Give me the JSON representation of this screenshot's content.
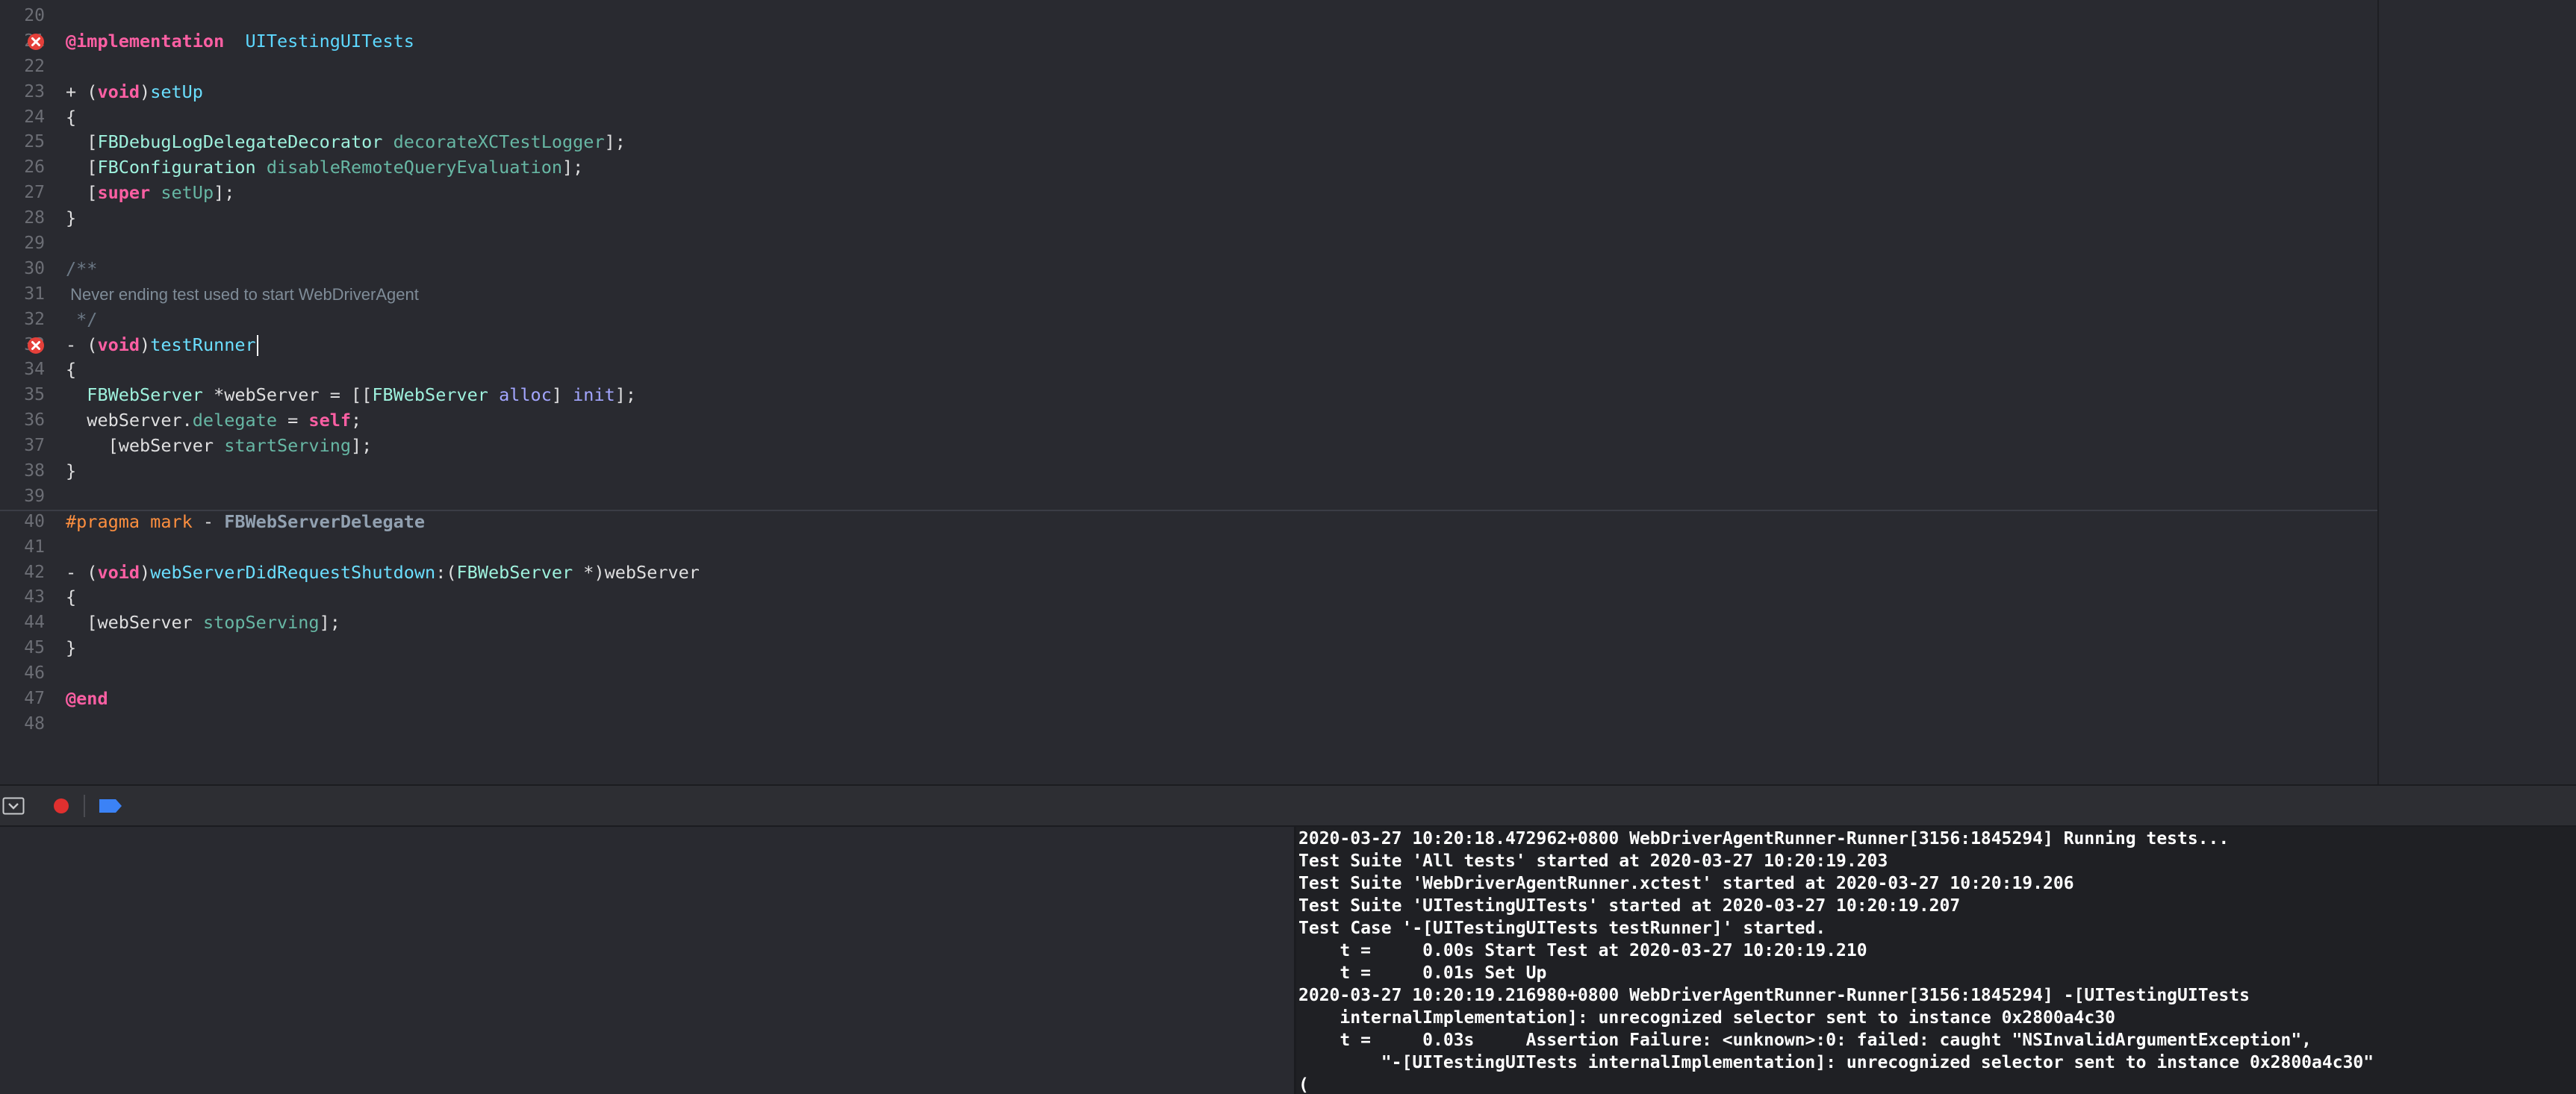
{
  "editor": {
    "lines": [
      {
        "n": "20",
        "error": false,
        "tokens": []
      },
      {
        "n": "21",
        "error": true,
        "tokens": [
          [
            "kw",
            "@implementation"
          ],
          [
            "",
            "  "
          ],
          [
            "dec",
            "UITestingUITests"
          ]
        ]
      },
      {
        "n": "22",
        "error": false,
        "tokens": []
      },
      {
        "n": "23",
        "error": false,
        "tokens": [
          [
            "",
            "+ ("
          ],
          [
            "kw",
            "void"
          ],
          [
            "",
            ")"
          ],
          [
            "dl",
            "setUp"
          ]
        ]
      },
      {
        "n": "24",
        "error": false,
        "tokens": [
          [
            "",
            "{"
          ]
        ]
      },
      {
        "n": "25",
        "error": false,
        "tokens": [
          [
            "",
            "  ["
          ],
          [
            "cls",
            "FBDebugLogDelegateDecorator"
          ],
          [
            "",
            " "
          ],
          [
            "fn",
            "decorateXCTestLogger"
          ],
          [
            "",
            "];"
          ]
        ]
      },
      {
        "n": "26",
        "error": false,
        "tokens": [
          [
            "",
            "  ["
          ],
          [
            "cls",
            "FBConfiguration"
          ],
          [
            "",
            " "
          ],
          [
            "fn",
            "disableRemoteQueryEvaluation"
          ],
          [
            "",
            "];"
          ]
        ]
      },
      {
        "n": "27",
        "error": false,
        "tokens": [
          [
            "",
            "  ["
          ],
          [
            "kw",
            "super"
          ],
          [
            "",
            " "
          ],
          [
            "fn",
            "setUp"
          ],
          [
            "",
            "];"
          ]
        ]
      },
      {
        "n": "28",
        "error": false,
        "tokens": [
          [
            "",
            "}"
          ]
        ]
      },
      {
        "n": "29",
        "error": false,
        "tokens": []
      },
      {
        "n": "30",
        "error": false,
        "tokens": [
          [
            "cm",
            "/**"
          ]
        ]
      },
      {
        "n": "31",
        "error": false,
        "tokens": [
          [
            "cm-doc",
            " Never ending test used to start WebDriverAgent"
          ]
        ]
      },
      {
        "n": "32",
        "error": false,
        "tokens": [
          [
            "cm",
            " */"
          ]
        ]
      },
      {
        "n": "33",
        "error": true,
        "active": true,
        "caret": true,
        "tokens": [
          [
            "",
            "- ("
          ],
          [
            "kw",
            "void"
          ],
          [
            "",
            ")"
          ],
          [
            "dl",
            "testRunner"
          ]
        ]
      },
      {
        "n": "34",
        "error": false,
        "tokens": [
          [
            "",
            "{"
          ]
        ]
      },
      {
        "n": "35",
        "error": false,
        "tokens": [
          [
            "",
            "  "
          ],
          [
            "cls",
            "FBWebServer"
          ],
          [
            "",
            " *webServer = [["
          ],
          [
            "cls",
            "FBWebServer"
          ],
          [
            "",
            " "
          ],
          [
            "ivar",
            "alloc"
          ],
          [
            "",
            "] "
          ],
          [
            "ivar",
            "init"
          ],
          [
            "",
            "];"
          ]
        ]
      },
      {
        "n": "36",
        "error": false,
        "tokens": [
          [
            "",
            "  webServer."
          ],
          [
            "fn",
            "delegate"
          ],
          [
            "",
            " = "
          ],
          [
            "kw",
            "self"
          ],
          [
            "",
            ";"
          ]
        ]
      },
      {
        "n": "37",
        "error": false,
        "tokens": [
          [
            "",
            "    [webServer "
          ],
          [
            "fn",
            "startServing"
          ],
          [
            "",
            "];"
          ]
        ]
      },
      {
        "n": "38",
        "error": false,
        "tokens": [
          [
            "",
            "}"
          ]
        ]
      },
      {
        "n": "39",
        "error": false,
        "tokens": []
      },
      {
        "n": "40",
        "error": false,
        "divider": true,
        "tokens": [
          [
            "pp",
            "#pragma mark"
          ],
          [
            "",
            " - "
          ],
          [
            "mark",
            "FBWebServerDelegate"
          ]
        ]
      },
      {
        "n": "41",
        "error": false,
        "tokens": []
      },
      {
        "n": "42",
        "error": false,
        "tokens": [
          [
            "",
            "- ("
          ],
          [
            "kw",
            "void"
          ],
          [
            "",
            ")"
          ],
          [
            "dl",
            "webServerDidRequestShutdown"
          ],
          [
            "",
            ":("
          ],
          [
            "cls",
            "FBWebServer"
          ],
          [
            "",
            " *)webServer"
          ]
        ]
      },
      {
        "n": "43",
        "error": false,
        "tokens": [
          [
            "",
            "{"
          ]
        ]
      },
      {
        "n": "44",
        "error": false,
        "tokens": [
          [
            "",
            "  [webServer "
          ],
          [
            "fn",
            "stopServing"
          ],
          [
            "",
            "];"
          ]
        ]
      },
      {
        "n": "45",
        "error": false,
        "tokens": [
          [
            "",
            "}"
          ]
        ]
      },
      {
        "n": "46",
        "error": false,
        "tokens": []
      },
      {
        "n": "47",
        "error": false,
        "tokens": [
          [
            "kw",
            "@end"
          ]
        ]
      },
      {
        "n": "48",
        "error": false,
        "tokens": []
      }
    ]
  },
  "debug_bar": {
    "hide_icon": "hide-debug-area-icon",
    "breakpoint_icon": "record-breakpoint-icon",
    "breakpoints_toggle_icon": "breakpoint-toggle-icon",
    "colors": {
      "breakpoint": "#e0302f",
      "toggle": "#3b82f6"
    }
  },
  "console": {
    "lines": [
      "2020-03-27 10:20:18.472962+0800 WebDriverAgentRunner-Runner[3156:1845294] Running tests...",
      "Test Suite 'All tests' started at 2020-03-27 10:20:19.203",
      "Test Suite 'WebDriverAgentRunner.xctest' started at 2020-03-27 10:20:19.206",
      "Test Suite 'UITestingUITests' started at 2020-03-27 10:20:19.207",
      "Test Case '-[UITestingUITests testRunner]' started.",
      "    t =     0.00s Start Test at 2020-03-27 10:20:19.210",
      "    t =     0.01s Set Up",
      "2020-03-27 10:20:19.216980+0800 WebDriverAgentRunner-Runner[3156:1845294] -[UITestingUITests",
      "    internalImplementation]: unrecognized selector sent to instance 0x2800a4c30",
      "    t =     0.03s     Assertion Failure: <unknown>:0: failed: caught \"NSInvalidArgumentException\",",
      "        \"-[UITestingUITests internalImplementation]: unrecognized selector sent to instance 0x2800a4c30\"",
      "("
    ]
  }
}
